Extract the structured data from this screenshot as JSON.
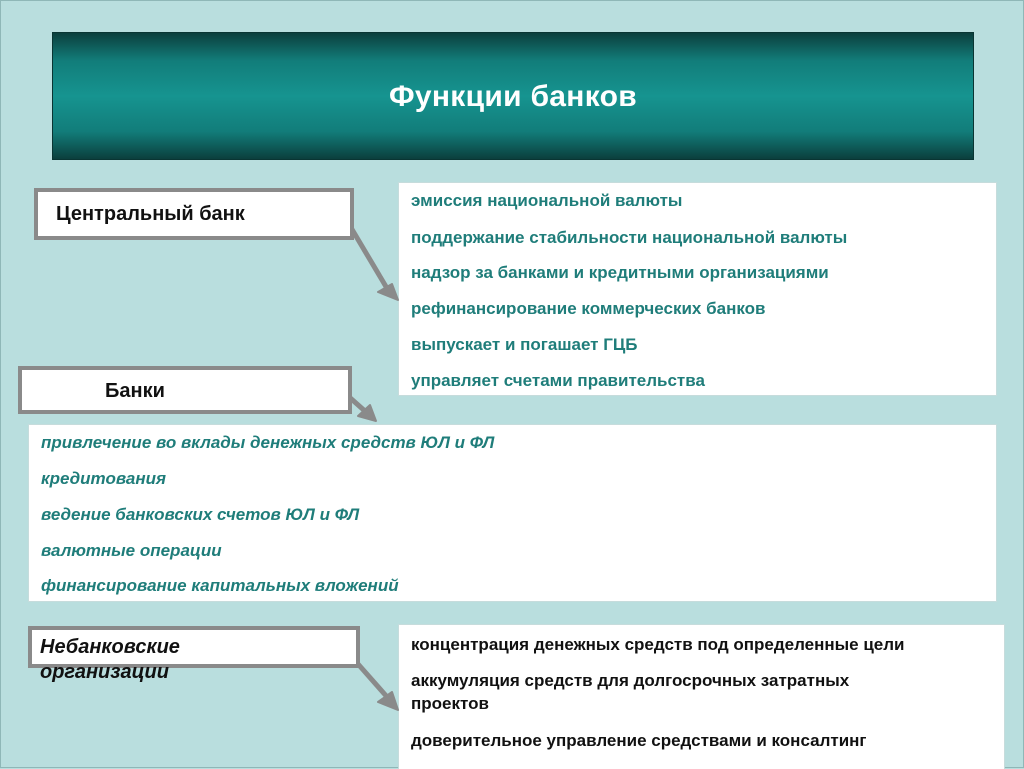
{
  "slide": {
    "title": "Функции банков"
  },
  "central_bank": {
    "label": "Центральный банк",
    "functions": [
      "эмиссия национальной валюты",
      "поддержание стабильности национальной валюты",
      "надзор за банками и кредитными организациями",
      "рефинансирование коммерческих банков",
      "выпускает и погашает ГЦБ",
      "управляет счетами правительства"
    ]
  },
  "banks": {
    "label": "Банки",
    "functions": [
      "привлечение во вклады денежных средств ЮЛ и ФЛ",
      "кредитования",
      "ведение банковских счетов ЮЛ и ФЛ",
      "валютные операции",
      "финансирование капитальных вложений"
    ]
  },
  "nonbank": {
    "label_line1": "Небанковские",
    "label_line2": "организации",
    "functions": [
      "концентрация денежных средств под определенные цели",
      "аккумуляция средств для долгосрочных затратных",
      "проектов",
      "доверительное управление  средствами и консалтинг"
    ]
  },
  "colors": {
    "background": "#b9dede",
    "banner": "#169490",
    "function_text": "#1f7d7a",
    "label_border": "#8a8a8a"
  }
}
